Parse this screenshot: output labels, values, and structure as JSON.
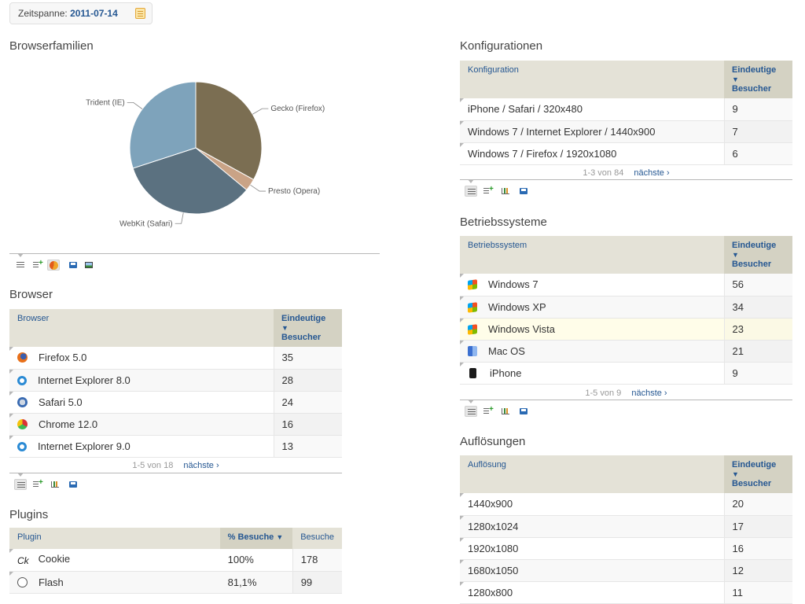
{
  "period": {
    "label": "Zeitspanne:",
    "value": "2011-07-14"
  },
  "browser_families": {
    "title": "Browserfamilien",
    "chart_data": {
      "type": "pie",
      "categories": [
        "Gecko (Firefox)",
        "Presto (Opera)",
        "WebKit (Safari)",
        "Trident (IE)"
      ],
      "values": [
        33,
        3,
        34,
        30
      ],
      "colors": [
        "#7b6e52",
        "#c9a386",
        "#5b7180",
        "#7ea3bb"
      ]
    }
  },
  "browser": {
    "title": "Browser",
    "col_label": "Browser",
    "col_value": "Eindeutige",
    "col_value2": "Besucher",
    "rows": [
      {
        "icon": "firefox",
        "label": "Firefox 5.0",
        "value": "35"
      },
      {
        "icon": "ie",
        "label": "Internet Explorer 8.0",
        "value": "28"
      },
      {
        "icon": "safari",
        "label": "Safari 5.0",
        "value": "24"
      },
      {
        "icon": "chrome",
        "label": "Chrome 12.0",
        "value": "16"
      },
      {
        "icon": "ie",
        "label": "Internet Explorer 9.0",
        "value": "13"
      }
    ],
    "pager": {
      "range": "1-5 von 18",
      "next": "nächste ›"
    }
  },
  "plugins": {
    "title": "Plugins",
    "col_label": "Plugin",
    "col_pct": "% Besuche",
    "col_visits": "Besuche",
    "rows": [
      {
        "icon": "cookie",
        "icon_text": "Ck",
        "label": "Cookie",
        "pct": "100%",
        "visits": "178"
      },
      {
        "icon": "flash",
        "label": "Flash",
        "pct": "81,1%",
        "visits": "99"
      }
    ]
  },
  "configurations": {
    "title": "Konfigurationen",
    "col_label": "Konfiguration",
    "col_value": "Eindeutige",
    "col_value2": "Besucher",
    "rows": [
      {
        "label": "iPhone / Safari / 320x480",
        "value": "9"
      },
      {
        "label": "Windows 7 / Internet Explorer / 1440x900",
        "value": "7"
      },
      {
        "label": "Windows 7 / Firefox / 1920x1080",
        "value": "6"
      }
    ],
    "pager": {
      "range": "1-3 von 84",
      "next": "nächste ›"
    }
  },
  "os": {
    "title": "Betriebssysteme",
    "col_label": "Betriebssystem",
    "col_value": "Eindeutige",
    "col_value2": "Besucher",
    "rows": [
      {
        "icon": "win",
        "label": "Windows 7",
        "value": "56"
      },
      {
        "icon": "win",
        "label": "Windows XP",
        "value": "34"
      },
      {
        "icon": "win",
        "label": "Windows Vista",
        "value": "23"
      },
      {
        "icon": "mac",
        "label": "Mac OS",
        "value": "21"
      },
      {
        "icon": "iphone",
        "label": "iPhone",
        "value": "9"
      }
    ],
    "pager": {
      "range": "1-5 von 9",
      "next": "nächste ›"
    }
  },
  "resolutions": {
    "title": "Auflösungen",
    "col_label": "Auflösung",
    "col_value": "Eindeutige",
    "col_value2": "Besucher",
    "rows": [
      {
        "label": "1440x900",
        "value": "20"
      },
      {
        "label": "1280x1024",
        "value": "17"
      },
      {
        "label": "1920x1080",
        "value": "16"
      },
      {
        "label": "1680x1050",
        "value": "12"
      },
      {
        "label": "1280x800",
        "value": "11"
      }
    ]
  },
  "toolbar_icons": [
    "table-icon",
    "table-more-icon",
    "bar-chart-icon",
    "pie-chart-icon",
    "export-icon",
    "image-icon"
  ]
}
